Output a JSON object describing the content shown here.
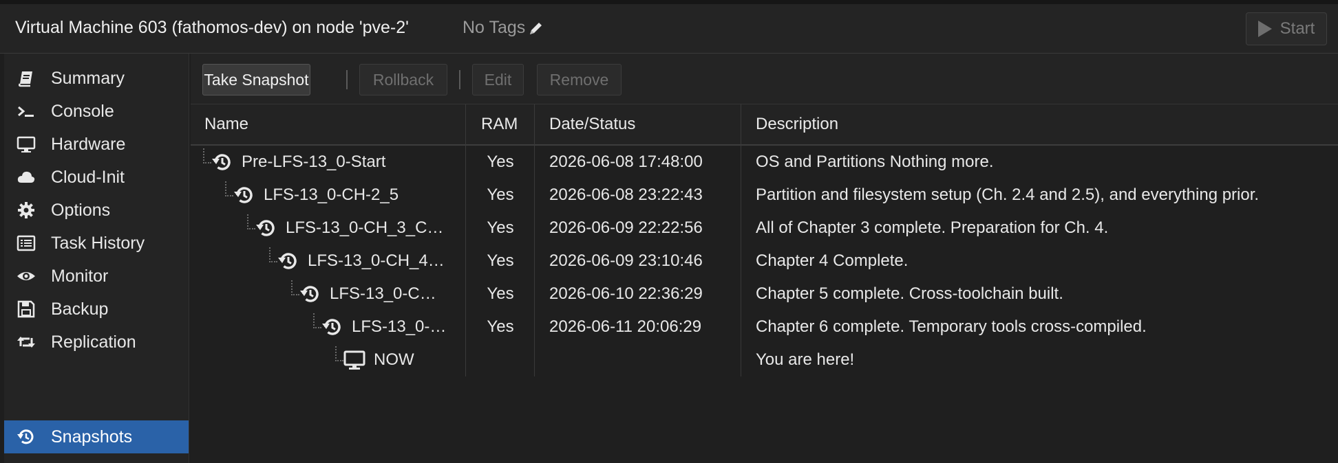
{
  "header": {
    "title": "Virtual Machine 603 (fathomos-dev) on node 'pve-2'",
    "tags": "No Tags",
    "start_label": "Start"
  },
  "sidebar": {
    "items": [
      {
        "label": "Summary",
        "icon": "book-icon"
      },
      {
        "label": "Console",
        "icon": "terminal-icon"
      },
      {
        "label": "Hardware",
        "icon": "monitor-icon"
      },
      {
        "label": "Cloud-Init",
        "icon": "cloud-icon"
      },
      {
        "label": "Options",
        "icon": "gear-icon"
      },
      {
        "label": "Task History",
        "icon": "list-icon"
      },
      {
        "label": "Monitor",
        "icon": "eye-icon"
      },
      {
        "label": "Backup",
        "icon": "floppy-icon"
      },
      {
        "label": "Replication",
        "icon": "retweet-icon"
      },
      {
        "label": "Snapshots",
        "icon": "history-icon",
        "active": true
      }
    ]
  },
  "toolbar": {
    "take_snapshot": "Take Snapshot",
    "rollback": "Rollback",
    "edit": "Edit",
    "remove": "Remove"
  },
  "grid": {
    "columns": [
      "Name",
      "RAM",
      "Date/Status",
      "Description"
    ],
    "rows": [
      {
        "name": "Pre-LFS-13_0-Start",
        "ram": "Yes",
        "date": "2026-06-08 17:48:00",
        "desc": "OS and Partitions Nothing more.",
        "depth": 0
      },
      {
        "name": "LFS-13_0-CH-2_5",
        "ram": "Yes",
        "date": "2026-06-08 23:22:43",
        "desc": "Partition and filesystem setup (Ch. 2.4 and 2.5), and everything prior.",
        "depth": 1
      },
      {
        "name": "LFS-13_0-CH_3_C…",
        "ram": "Yes",
        "date": "2026-06-09 22:22:56",
        "desc": "All of Chapter 3 complete. Preparation for Ch. 4.",
        "depth": 2
      },
      {
        "name": "LFS-13_0-CH_4…",
        "ram": "Yes",
        "date": "2026-06-09 23:10:46",
        "desc": "Chapter 4 Complete.",
        "depth": 3
      },
      {
        "name": "LFS-13_0-C…",
        "ram": "Yes",
        "date": "2026-06-10 22:36:29",
        "desc": "Chapter 5 complete. Cross-toolchain built.",
        "depth": 4
      },
      {
        "name": "LFS-13_0-…",
        "ram": "Yes",
        "date": "2026-06-11 20:06:29",
        "desc": "Chapter 6 complete. Temporary tools cross-compiled.",
        "depth": 5
      },
      {
        "name": "NOW",
        "ram": "",
        "date": "",
        "desc": "You are here!",
        "depth": 6,
        "current": true
      }
    ]
  }
}
